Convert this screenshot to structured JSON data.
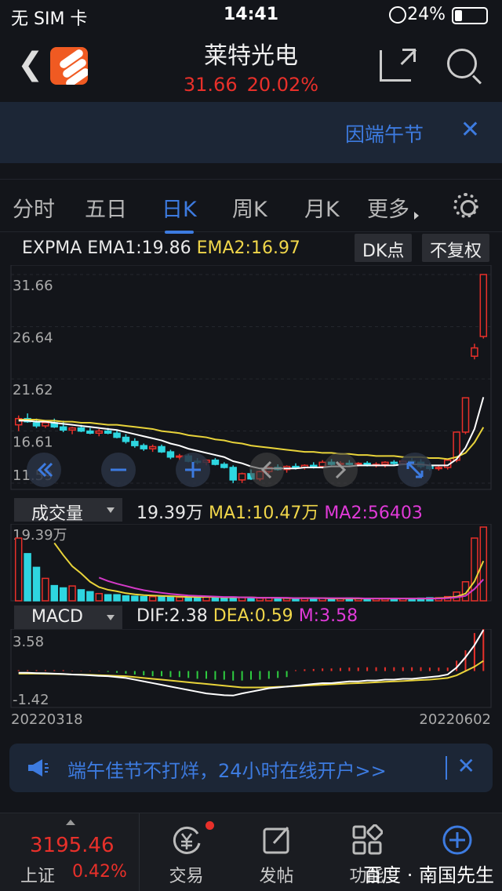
{
  "status_bar": {
    "carrier": "无 SIM 卡",
    "time": "14:41",
    "battery": "24%"
  },
  "header": {
    "title": "莱特光电",
    "price": "31.66",
    "change_pct": "20.02%"
  },
  "notice": {
    "text": "因端午节"
  },
  "tabs": [
    {
      "label": "分时"
    },
    {
      "label": "五日"
    },
    {
      "label": "日K",
      "active": true
    },
    {
      "label": "周K"
    },
    {
      "label": "月K"
    },
    {
      "label": "更多"
    }
  ],
  "indicator": {
    "name": "EXPMA",
    "ema1": "EMA1:19.86",
    "ema2": "EMA2:16.97",
    "dk_button": "DK点",
    "adjust_button": "不复权"
  },
  "volume": {
    "select": "成交量",
    "value": "19.39万",
    "ma1": "MA1:10.47万",
    "ma2": "MA2:56403"
  },
  "macd": {
    "select": "MACD",
    "dif": "DIF:2.38",
    "dea": "DEA:0.59",
    "m": "M:3.58"
  },
  "ad": {
    "text": "端午佳节不打烊，24小时在线开户>>"
  },
  "bottom": {
    "index_value": "3195.46",
    "index_name": "上证",
    "index_pct": "0.42%",
    "nav": [
      {
        "label": "交易"
      },
      {
        "label": "发帖"
      },
      {
        "label": "功能"
      },
      {
        "label": ""
      }
    ]
  },
  "watermark": "百度 · 南国先生",
  "chart_data": [
    {
      "type": "candlestick",
      "y_ticks": [
        "31.66",
        "26.64",
        "21.62",
        "16.61",
        "11.59"
      ],
      "ylim": [
        11.59,
        31.66
      ],
      "start_date": "20220318",
      "end_date": "20220602",
      "ohlc": [
        [
          17.2,
          18.1,
          16.6,
          17.8
        ],
        [
          17.8,
          18.3,
          17.4,
          17.5
        ],
        [
          17.4,
          17.8,
          16.9,
          17.1
        ],
        [
          17.1,
          17.6,
          16.9,
          17.4
        ],
        [
          17.4,
          17.8,
          16.9,
          17.0
        ],
        [
          17.0,
          17.6,
          16.5,
          16.7
        ],
        [
          16.7,
          17.0,
          16.3,
          16.9
        ],
        [
          16.9,
          17.2,
          16.5,
          16.6
        ],
        [
          16.6,
          16.9,
          16.3,
          16.4
        ],
        [
          16.4,
          16.8,
          16.1,
          16.6
        ],
        [
          16.6,
          16.9,
          16.3,
          16.4
        ],
        [
          16.4,
          16.7,
          15.9,
          16.0
        ],
        [
          16.0,
          16.3,
          15.4,
          15.6
        ],
        [
          15.6,
          15.9,
          15.0,
          15.2
        ],
        [
          15.2,
          15.4,
          14.7,
          14.9
        ],
        [
          14.9,
          15.3,
          14.6,
          15.1
        ],
        [
          15.1,
          15.3,
          14.5,
          14.6
        ],
        [
          14.6,
          14.8,
          13.9,
          14.1
        ],
        [
          14.1,
          14.4,
          13.8,
          14.2
        ],
        [
          14.2,
          14.4,
          13.6,
          13.7
        ],
        [
          13.7,
          14.0,
          13.4,
          13.6
        ],
        [
          13.6,
          13.9,
          13.3,
          13.8
        ],
        [
          13.8,
          14.0,
          13.3,
          13.4
        ],
        [
          13.4,
          13.6,
          13.0,
          13.1
        ],
        [
          13.1,
          13.3,
          11.6,
          11.9
        ],
        [
          11.9,
          12.6,
          11.6,
          12.5
        ],
        [
          12.5,
          12.9,
          11.9,
          12.0
        ],
        [
          12.0,
          12.8,
          11.8,
          12.7
        ],
        [
          12.7,
          13.2,
          12.5,
          13.1
        ],
        [
          13.1,
          13.4,
          12.8,
          12.9
        ],
        [
          12.9,
          13.3,
          12.6,
          13.2
        ],
        [
          13.2,
          13.5,
          12.9,
          13.1
        ],
        [
          13.1,
          13.4,
          12.9,
          13.3
        ],
        [
          13.3,
          13.6,
          13.0,
          13.2
        ],
        [
          13.2,
          13.8,
          13.0,
          13.6
        ],
        [
          13.6,
          13.9,
          13.3,
          13.4
        ],
        [
          13.4,
          13.7,
          13.1,
          13.5
        ],
        [
          13.5,
          13.8,
          13.3,
          13.4
        ],
        [
          13.4,
          13.6,
          13.2,
          13.5
        ],
        [
          13.5,
          13.7,
          13.2,
          13.3
        ],
        [
          13.3,
          13.6,
          13.1,
          13.4
        ],
        [
          13.4,
          13.7,
          13.1,
          13.6
        ],
        [
          13.6,
          13.8,
          13.3,
          13.5
        ],
        [
          13.5,
          13.8,
          13.3,
          13.7
        ],
        [
          13.7,
          14.0,
          13.4,
          13.6
        ],
        [
          13.6,
          13.9,
          13.0,
          13.2
        ],
        [
          13.2,
          13.5,
          12.8,
          13.0
        ],
        [
          13.0,
          13.3,
          12.8,
          13.1
        ],
        [
          13.1,
          13.9,
          12.9,
          13.8
        ],
        [
          13.8,
          16.5,
          13.6,
          16.5
        ],
        [
          16.5,
          19.8,
          16.3,
          19.8
        ],
        [
          23.8,
          25.0,
          23.5,
          24.6
        ],
        [
          25.7,
          31.66,
          25.5,
          31.66
        ]
      ],
      "ema1_values": [
        17.6,
        17.6,
        17.5,
        17.5,
        17.4,
        17.3,
        17.2,
        17.1,
        17.0,
        16.9,
        16.8,
        16.7,
        16.5,
        16.3,
        16.1,
        15.9,
        15.7,
        15.4,
        15.2,
        14.9,
        14.7,
        14.5,
        14.3,
        14.1,
        13.7,
        13.5,
        13.2,
        13.0,
        13.0,
        13.0,
        13.0,
        13.0,
        13.1,
        13.1,
        13.1,
        13.2,
        13.2,
        13.2,
        13.3,
        13.3,
        13.3,
        13.3,
        13.3,
        13.4,
        13.4,
        13.4,
        13.3,
        13.3,
        13.3,
        13.9,
        15.0,
        16.8,
        19.86
      ],
      "ema2_values": [
        17.7,
        17.7,
        17.7,
        17.6,
        17.6,
        17.5,
        17.5,
        17.4,
        17.4,
        17.3,
        17.2,
        17.2,
        17.1,
        17.0,
        16.9,
        16.8,
        16.6,
        16.5,
        16.4,
        16.2,
        16.1,
        16.0,
        15.8,
        15.7,
        15.5,
        15.4,
        15.2,
        15.1,
        15.0,
        14.9,
        14.8,
        14.7,
        14.6,
        14.6,
        14.5,
        14.5,
        14.4,
        14.4,
        14.3,
        14.3,
        14.2,
        14.2,
        14.2,
        14.1,
        14.1,
        14.1,
        14.0,
        14.0,
        13.9,
        14.1,
        14.5,
        15.5,
        16.97
      ]
    },
    {
      "type": "bar",
      "name": "volume",
      "y_ticks": [
        "19.39万"
      ],
      "values": [
        16.5,
        12.4,
        8.8,
        5.9,
        4.0,
        3.4,
        3.9,
        2.9,
        2.4,
        1.9,
        1.6,
        1.6,
        1.3,
        1.2,
        1.1,
        1.1,
        1.0,
        1.0,
        0.9,
        1.0,
        0.9,
        1.0,
        0.8,
        0.9,
        1.0,
        0.9,
        0.7,
        0.7,
        0.8,
        0.7,
        0.7,
        0.6,
        0.6,
        0.7,
        0.7,
        0.6,
        0.6,
        0.7,
        0.6,
        0.6,
        0.6,
        0.5,
        0.6,
        0.6,
        0.6,
        0.7,
        0.8,
        0.8,
        1.1,
        2.3,
        5.0,
        16.5,
        19.39
      ],
      "ma1_values": [
        null,
        null,
        null,
        null,
        15.2,
        12.0,
        9.1,
        7.2,
        5.0,
        3.6,
        2.9,
        2.5,
        2.0,
        1.7,
        1.5,
        1.4,
        1.3,
        1.2,
        1.1,
        1.0,
        1.0,
        1.0,
        1.0,
        0.9,
        0.9,
        0.9,
        0.9,
        0.8,
        0.8,
        0.8,
        0.7,
        0.7,
        0.7,
        0.7,
        0.7,
        0.6,
        0.6,
        0.6,
        0.6,
        0.6,
        0.6,
        0.6,
        0.6,
        0.6,
        0.6,
        0.6,
        0.6,
        0.7,
        0.8,
        1.1,
        1.9,
        5.1,
        10.47
      ],
      "ma2_values": [
        null,
        null,
        null,
        null,
        null,
        null,
        null,
        null,
        null,
        6.1,
        5.2,
        4.5,
        3.9,
        3.3,
        2.8,
        2.4,
        2.1,
        1.8,
        1.6,
        1.4,
        1.3,
        1.2,
        1.1,
        1.0,
        1.0,
        0.9,
        0.9,
        0.8,
        0.8,
        0.8,
        0.8,
        0.7,
        0.7,
        0.7,
        0.7,
        0.7,
        0.7,
        0.7,
        0.7,
        0.6,
        0.6,
        0.6,
        0.6,
        0.6,
        0.6,
        0.6,
        0.6,
        0.6,
        0.7,
        0.9,
        1.3,
        3.1,
        5.64
      ]
    },
    {
      "type": "macd",
      "y_ticks": [
        "3.58",
        "-1.42"
      ],
      "ylim": [
        -1.42,
        3.58
      ],
      "hist": [
        0.05,
        0.05,
        0.05,
        0.05,
        0.05,
        0.05,
        0.02,
        0.02,
        0.02,
        0.02,
        -0.05,
        -0.1,
        -0.15,
        -0.2,
        -0.25,
        -0.3,
        -0.3,
        -0.35,
        -0.35,
        -0.4,
        -0.45,
        -0.45,
        -0.5,
        -0.5,
        -0.55,
        -0.55,
        -0.5,
        -0.5,
        -0.45,
        -0.4,
        -0.35,
        0.05,
        0.1,
        0.12,
        0.15,
        0.15,
        0.18,
        0.2,
        0.2,
        0.22,
        0.22,
        0.22,
        0.22,
        0.22,
        0.22,
        0.22,
        0.2,
        0.2,
        0.2,
        0.6,
        1.2,
        2.2,
        3.58
      ],
      "dif": [
        -0.1,
        -0.1,
        -0.12,
        -0.13,
        -0.15,
        -0.17,
        -0.2,
        -0.22,
        -0.25,
        -0.28,
        -0.3,
        -0.35,
        -0.4,
        -0.5,
        -0.6,
        -0.7,
        -0.8,
        -0.9,
        -1.0,
        -1.1,
        -1.2,
        -1.3,
        -1.35,
        -1.4,
        -1.42,
        -1.3,
        -1.2,
        -1.1,
        -1.0,
        -0.95,
        -0.9,
        -0.85,
        -0.8,
        -0.75,
        -0.7,
        -0.7,
        -0.65,
        -0.6,
        -0.6,
        -0.55,
        -0.55,
        -0.5,
        -0.5,
        -0.45,
        -0.45,
        -0.4,
        -0.35,
        -0.3,
        -0.2,
        0.2,
        0.8,
        1.5,
        2.38
      ],
      "dea": [
        -0.15,
        -0.15,
        -0.15,
        -0.16,
        -0.17,
        -0.18,
        -0.2,
        -0.21,
        -0.22,
        -0.24,
        -0.26,
        -0.28,
        -0.3,
        -0.35,
        -0.4,
        -0.45,
        -0.5,
        -0.55,
        -0.6,
        -0.65,
        -0.7,
        -0.75,
        -0.8,
        -0.85,
        -0.9,
        -0.95,
        -0.95,
        -0.95,
        -0.94,
        -0.92,
        -0.9,
        -0.88,
        -0.85,
        -0.82,
        -0.8,
        -0.77,
        -0.75,
        -0.72,
        -0.7,
        -0.68,
        -0.65,
        -0.62,
        -0.6,
        -0.58,
        -0.55,
        -0.52,
        -0.5,
        -0.45,
        -0.4,
        -0.25,
        0.0,
        0.25,
        0.59
      ]
    }
  ],
  "colors": {
    "up": "#e8302a",
    "down": "#2ed6e0",
    "ema1": "#ffffff",
    "ema2": "#e8d33a",
    "ma2": "#d43ac8",
    "accent": "#3d7be0"
  }
}
